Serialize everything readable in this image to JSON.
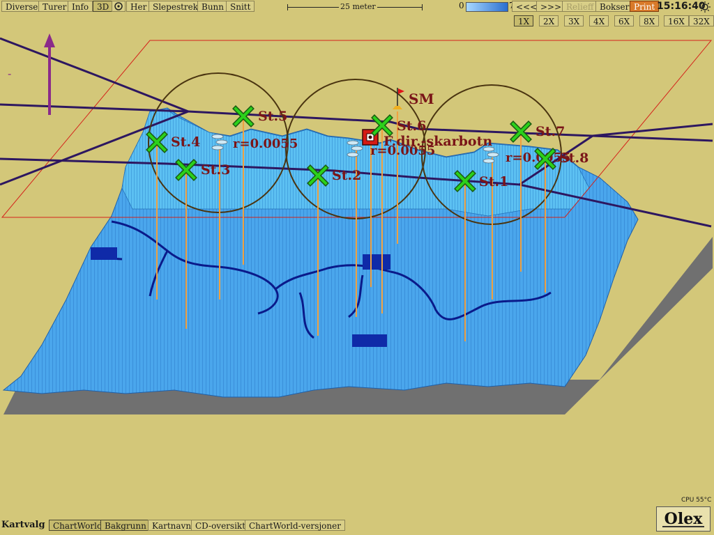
{
  "menu": {
    "diverse": "Diverse",
    "turer": "Turer",
    "info": "Info",
    "three_d": "3D",
    "her": "Her",
    "slepestrek": "Slepestrek",
    "bunn": "Bunn",
    "snitt": "Snitt"
  },
  "scale_bar": {
    "label": "25 meter"
  },
  "depth_legend": {
    "min": "0",
    "max": "75"
  },
  "nav": {
    "back": "<<<",
    "forward": ">>>",
    "relieff": "Relieff",
    "bokser": "Bokser",
    "print": "Print"
  },
  "clock": "15:16:40",
  "zoom": [
    "1X",
    "2X",
    "3X",
    "4X",
    "6X",
    "8X",
    "16X",
    "32X"
  ],
  "zoom_active": "1X",
  "stations": [
    {
      "label": "St.1"
    },
    {
      "label": "St.2"
    },
    {
      "label": "St.3"
    },
    {
      "label": "St.4"
    },
    {
      "label": "St.5"
    },
    {
      "label": "St.6"
    },
    {
      "label": "St.7"
    },
    {
      "label": "St.8"
    }
  ],
  "radius_labels": [
    "r=0.0055",
    "r=0.0055",
    "r=0.0055"
  ],
  "markers": {
    "flag": "SM",
    "box": "F.dir.-skarbotn"
  },
  "bottom": {
    "label": "Kartvalg",
    "chartworld": "ChartWorld",
    "bakgrunn": "Bakgrunn",
    "kartnavn": "Kartnavn",
    "cd_oversikt": "CD-oversikt",
    "chartworld_versjoner": "ChartWorld-versjoner"
  },
  "cpu": "CPU 55°C",
  "logo": "Olex",
  "colors": {
    "background": "#d3c779",
    "seabed": "#3f9ae6",
    "seabed_light": "#56b3f0",
    "contour": "#0a1a8a",
    "track": "#2d1760",
    "station_marker": "#2bd11b",
    "label": "#7a1518",
    "pole": "#f0a040"
  }
}
